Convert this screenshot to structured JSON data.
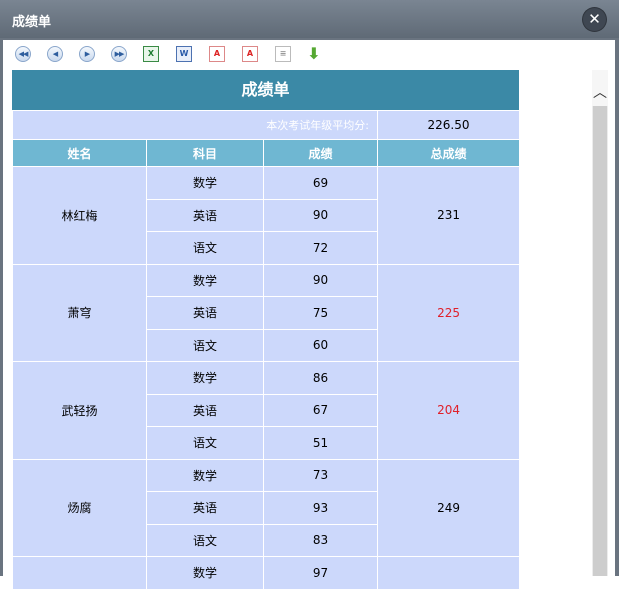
{
  "window": {
    "title": "成绩单",
    "close_icon": "close-icon"
  },
  "toolbar": {
    "items": [
      "first-page-icon",
      "prev-page-icon",
      "next-page-icon",
      "last-page-icon",
      "export-excel-icon",
      "export-word-icon",
      "export-pdf-icon",
      "export-pdf-alt-icon",
      "export-text-icon",
      "download-icon"
    ]
  },
  "report": {
    "title": "成绩单",
    "average_label": "本次考试年级平均分:",
    "average_value": "226.50",
    "headers": {
      "name": "姓名",
      "subject": "科目",
      "score": "成绩",
      "total": "总成绩"
    },
    "students": [
      {
        "name": "林红梅",
        "total": "231",
        "total_color": "#000000",
        "rows": [
          {
            "subject": "数学",
            "score": "69"
          },
          {
            "subject": "英语",
            "score": "90"
          },
          {
            "subject": "语文",
            "score": "72"
          }
        ]
      },
      {
        "name": "萧穹",
        "total": "225",
        "total_color": "#e0202a",
        "rows": [
          {
            "subject": "数学",
            "score": "90"
          },
          {
            "subject": "英语",
            "score": "75"
          },
          {
            "subject": "语文",
            "score": "60"
          }
        ]
      },
      {
        "name": "武轻扬",
        "total": "204",
        "total_color": "#e0202a",
        "rows": [
          {
            "subject": "数学",
            "score": "86"
          },
          {
            "subject": "英语",
            "score": "67"
          },
          {
            "subject": "语文",
            "score": "51"
          }
        ]
      },
      {
        "name": "炀腐",
        "total": "249",
        "total_color": "#000000",
        "rows": [
          {
            "subject": "数学",
            "score": "73"
          },
          {
            "subject": "英语",
            "score": "93"
          },
          {
            "subject": "语文",
            "score": "83"
          }
        ]
      },
      {
        "name": "",
        "total": "",
        "total_color": "#000000",
        "rows": [
          {
            "subject": "数学",
            "score": "97"
          }
        ]
      }
    ]
  },
  "colors": {
    "title_bg": "#3b89a6",
    "header_bg": "#6fb7d2",
    "cell_bg": "#ccd8fb",
    "fail_red": "#e0202a"
  }
}
